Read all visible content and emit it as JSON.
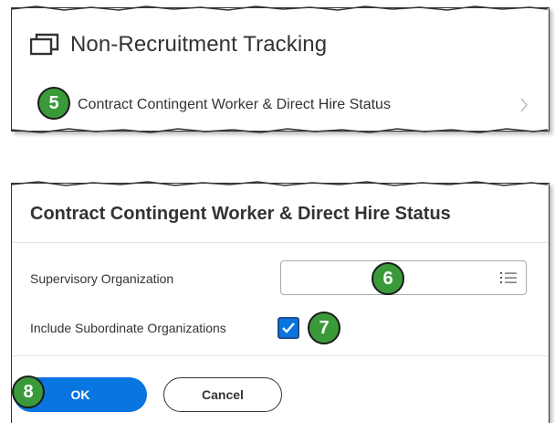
{
  "tracking": {
    "title": "Non-Recruitment Tracking"
  },
  "report": {
    "link_label": "Contract Contingent Worker & Direct Hire Status"
  },
  "dialog": {
    "title": "Contract Contingent Worker & Direct Hire Status",
    "supervisory_label": "Supervisory Organization",
    "supervisory_value": "",
    "include_label": "Include Subordinate Organizations",
    "include_checked": true,
    "ok_label": "OK",
    "cancel_label": "Cancel"
  },
  "callouts": {
    "step5": "5",
    "step6": "6",
    "step7": "7",
    "step8": "8"
  },
  "colors": {
    "callout": "#3a9a3a",
    "primary": "#0875e1",
    "text": "#333333"
  },
  "icons": {
    "window": "window-icon",
    "chevron": "chevron-right-icon",
    "list": "list-icon",
    "check": "check-icon"
  }
}
